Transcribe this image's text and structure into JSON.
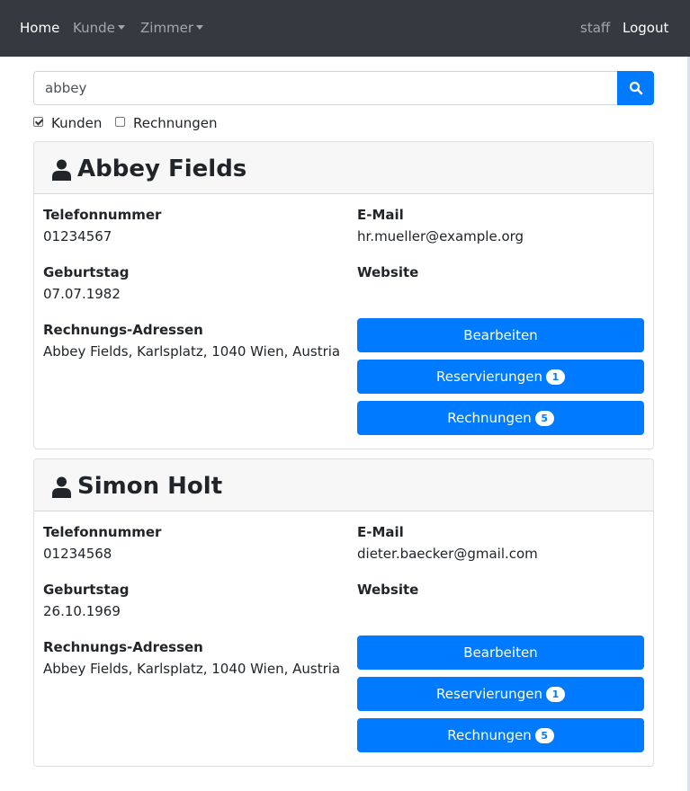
{
  "nav": {
    "home": "Home",
    "kunde": "Kunde",
    "zimmer": "Zimmer",
    "user": "staff",
    "logout": "Logout"
  },
  "search": {
    "value": "abbey",
    "placeholder": ""
  },
  "filters": {
    "kunden": {
      "label": "Kunden",
      "checked": true
    },
    "rechnungen": {
      "label": "Rechnungen",
      "checked": false
    }
  },
  "labels": {
    "phone": "Telefonnummer",
    "email": "E-Mail",
    "birthday": "Geburtstag",
    "website": "Website",
    "address": "Rechnungs-Adressen"
  },
  "buttons": {
    "edit": "Bearbeiten",
    "reservations": "Reservierungen",
    "invoices": "Rechnungen"
  },
  "customers": [
    {
      "name": "Abbey Fields",
      "phone": "01234567",
      "email": "hr.mueller@example.org",
      "birthday": "07.07.1982",
      "website": "",
      "address": "Abbey Fields, Karlsplatz, 1040 Wien, Austria",
      "reservations_count": "1",
      "invoices_count": "5"
    },
    {
      "name": "Simon Holt",
      "phone": "01234568",
      "email": "dieter.baecker@gmail.com",
      "birthday": "26.10.1969",
      "website": "",
      "address": "Abbey Fields, Karlsplatz, 1040 Wien, Austria",
      "reservations_count": "1",
      "invoices_count": "5"
    }
  ],
  "colors": {
    "navbar": "#343a40",
    "primary": "#007bff",
    "card_header": "#f7f7f7"
  }
}
